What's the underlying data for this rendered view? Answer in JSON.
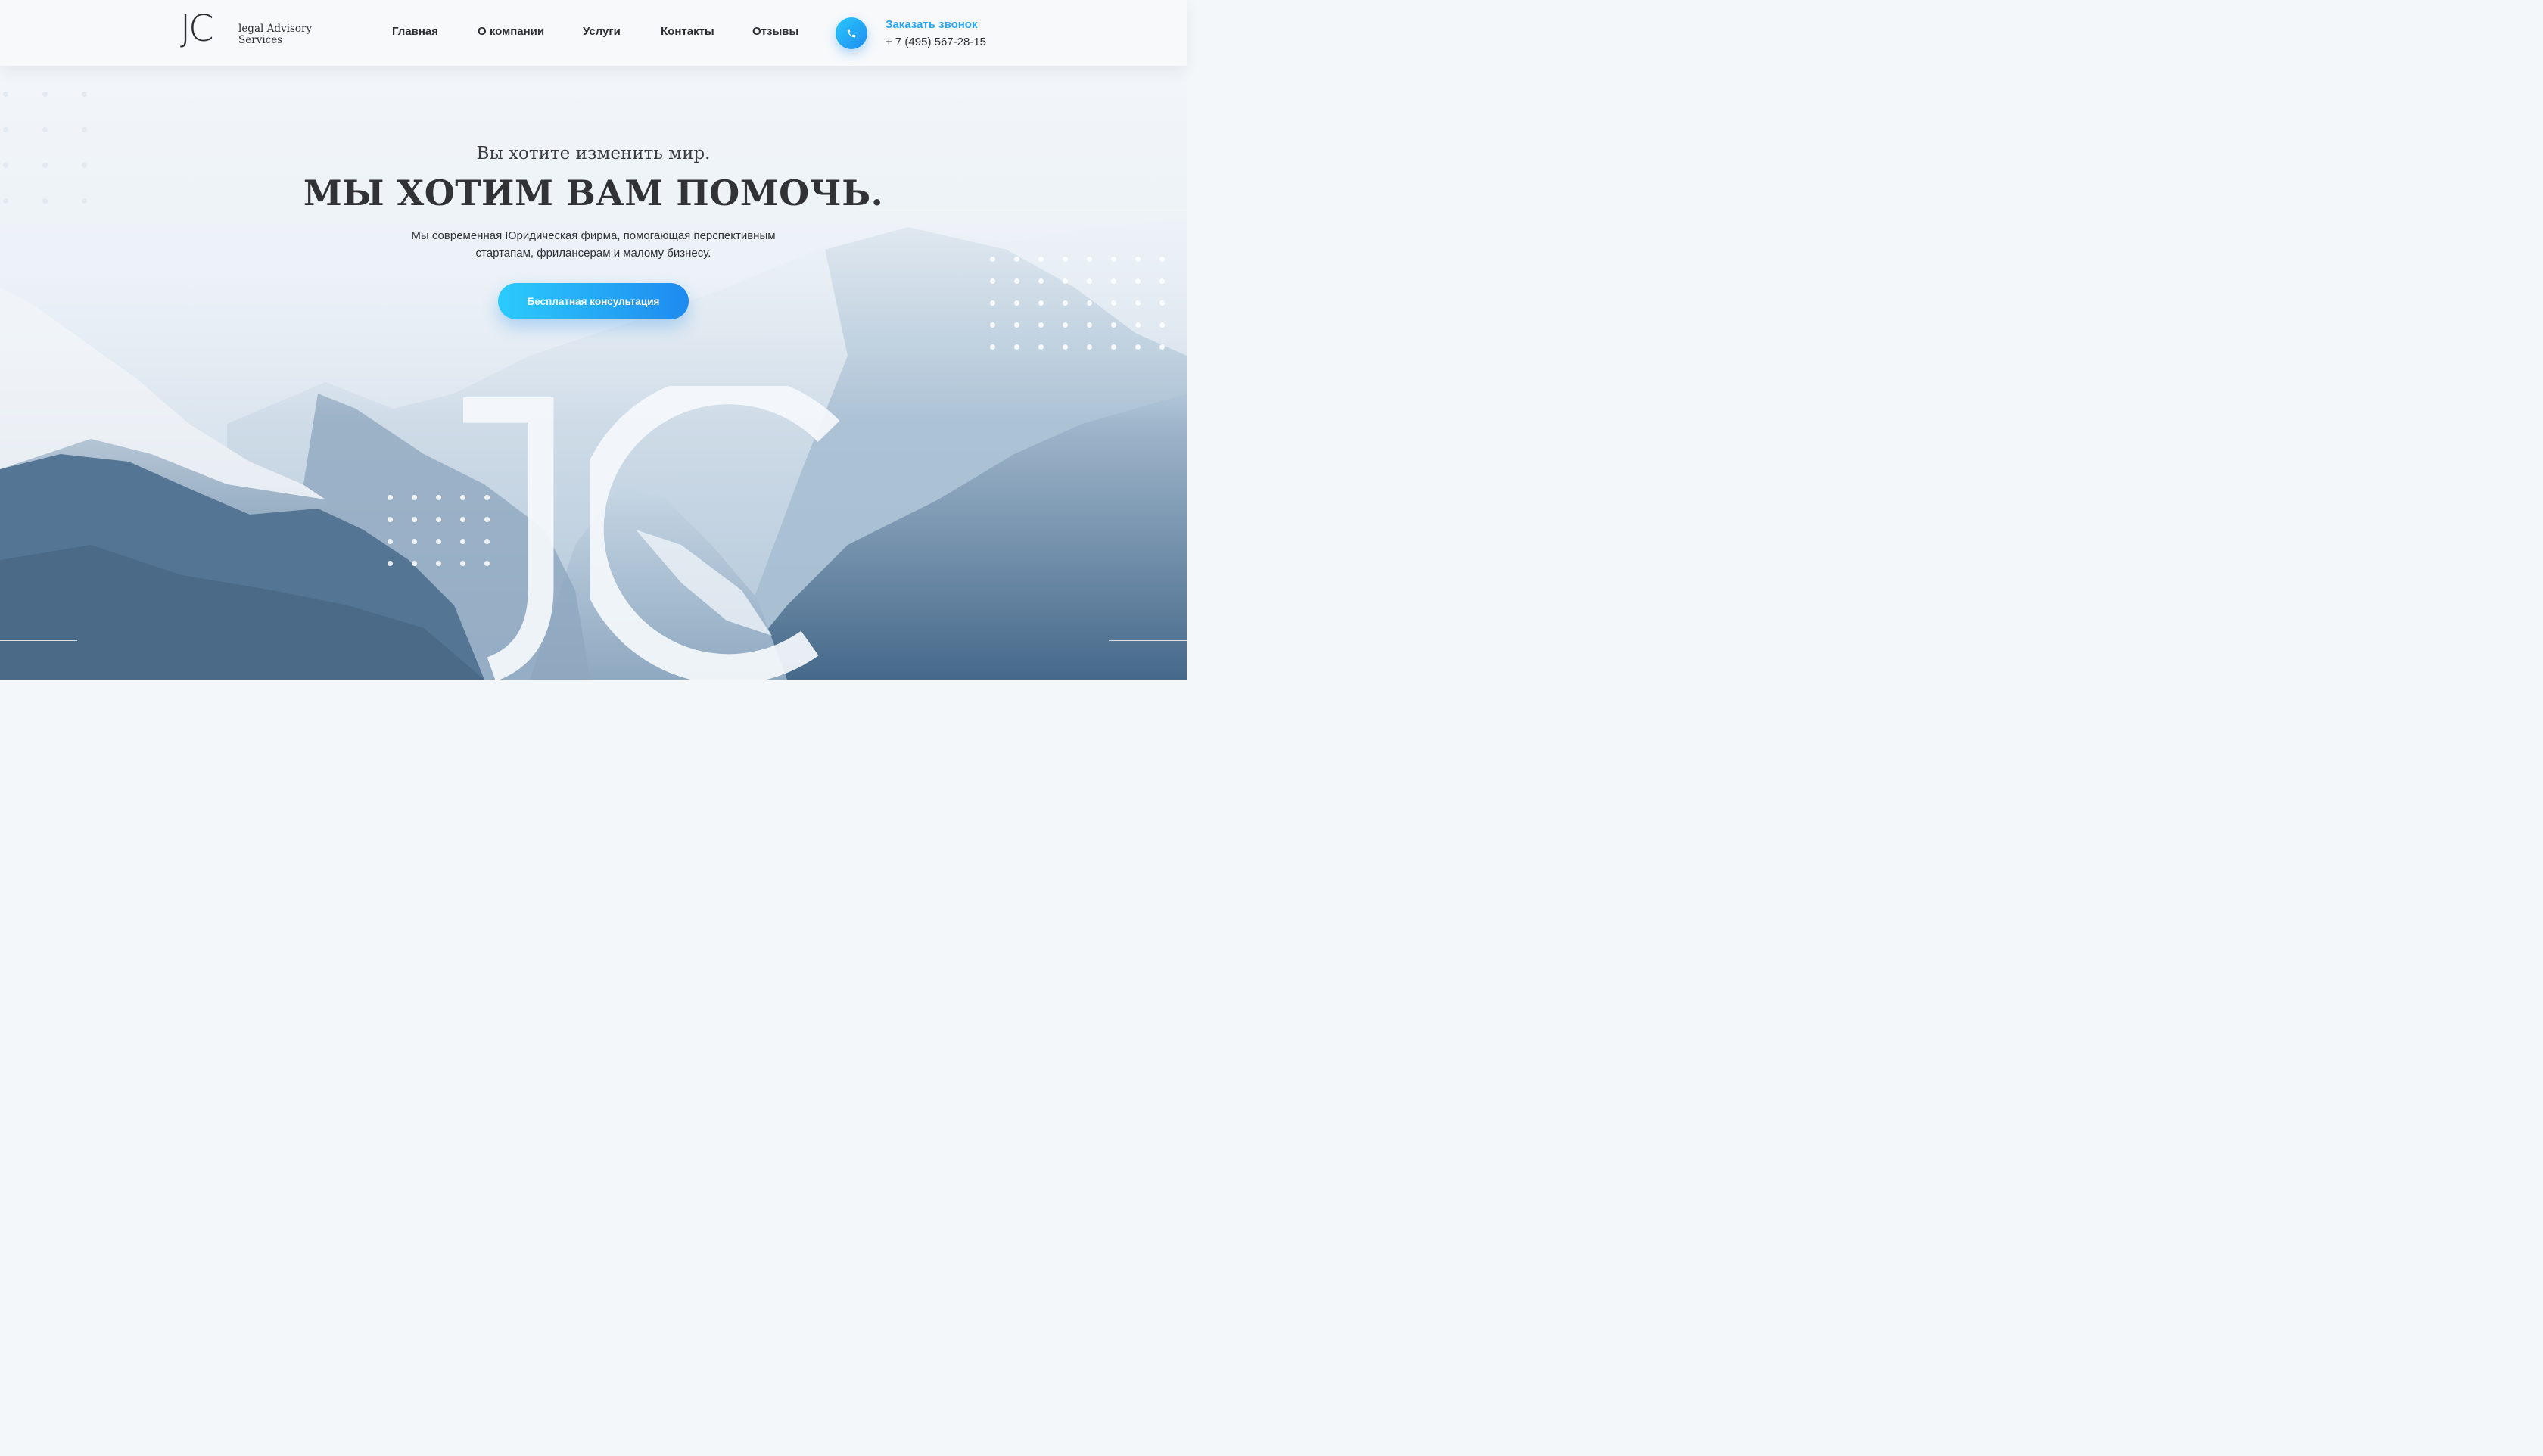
{
  "header": {
    "logo_mark": "JC",
    "logo_line1": "legal Advisory",
    "logo_line2": "Services",
    "nav": [
      "Главная",
      "О компании",
      "Услуги",
      "Контакты",
      "Отзывы"
    ],
    "callback_label": "Заказать звонок",
    "phone": "+ 7 (495) 567-28-15",
    "phone_icon": "phone-icon"
  },
  "hero": {
    "subtitle": "Вы хотите изменить мир.",
    "headline": "МЫ ХОТИМ ВАМ ПОМОЧЬ.",
    "description_line1": "Мы современная Юридическая фирма, помогающая перспективным",
    "description_line2": "стартапам, фрилансерам и малому бизнесу.",
    "cta_label": "Бесплатная консультация",
    "watermark": "JC"
  },
  "colors": {
    "accent": "#29a6ee",
    "accent_gradient_start": "#2bcbfc",
    "accent_gradient_end": "#1e8af0",
    "text_dark": "#2c2e33"
  }
}
